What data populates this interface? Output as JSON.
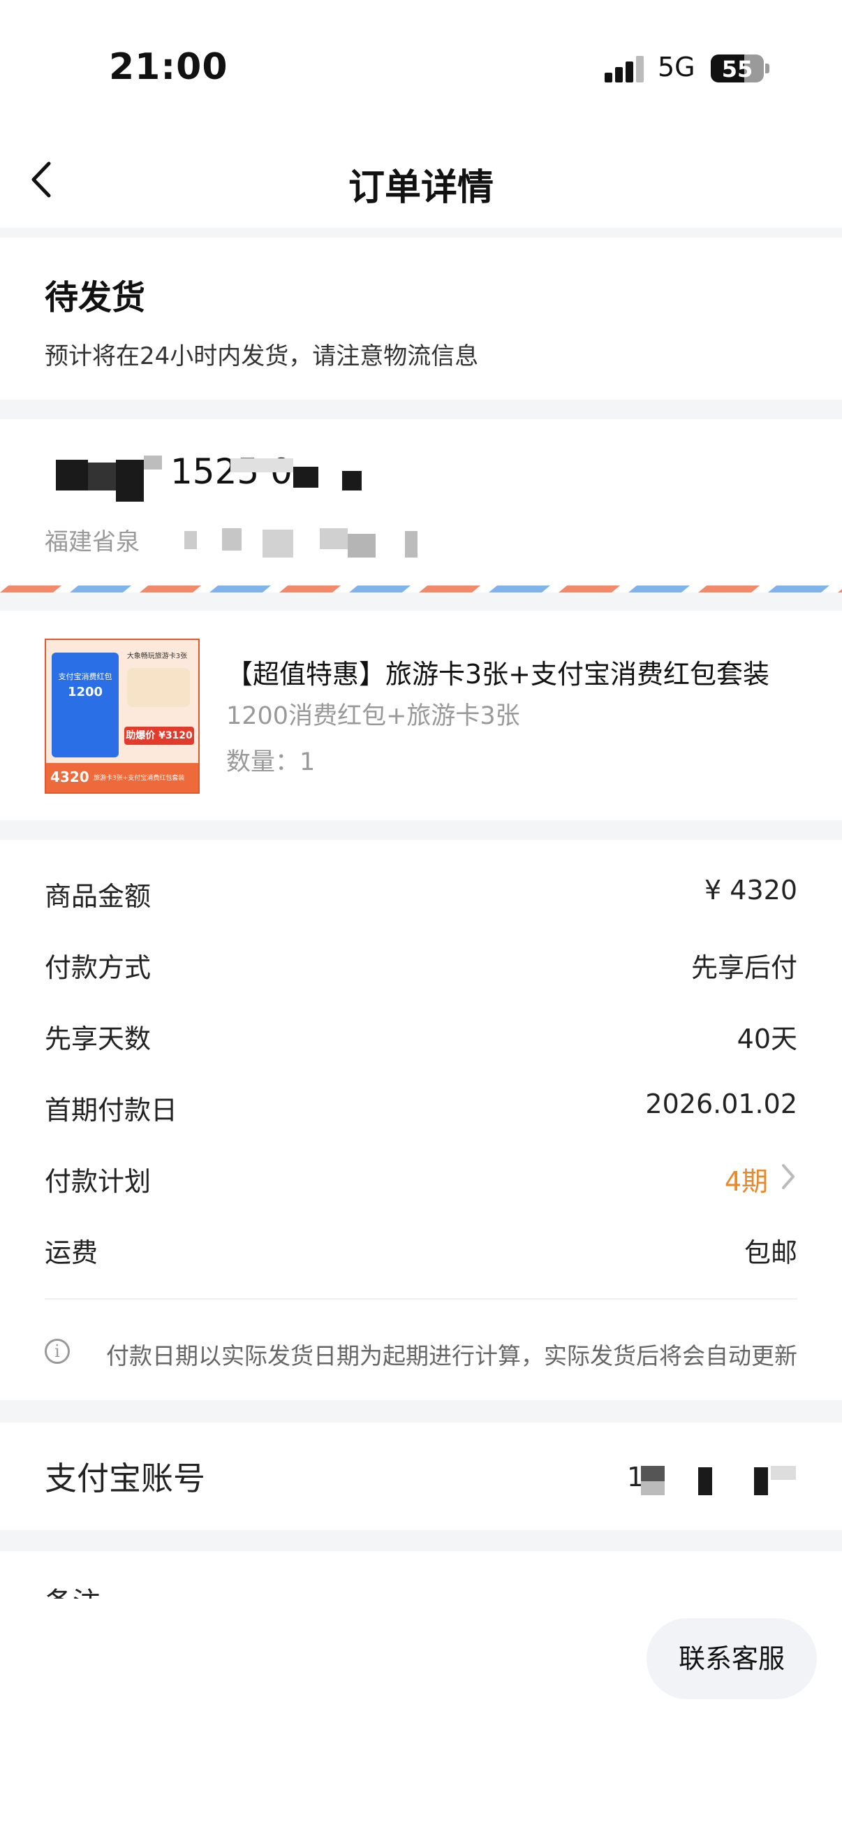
{
  "status_bar": {
    "time": "21:00",
    "network": "5G",
    "battery": "55"
  },
  "nav": {
    "title": "订单详情",
    "back_icon": "chevron-left-icon"
  },
  "order_status": {
    "title": "待发货",
    "subtitle": "预计将在24小时内发货，请注意物流信息"
  },
  "address": {
    "name_phone_visible": "1525 0",
    "region": "福建省泉"
  },
  "product": {
    "title": "【超值特惠】旅游卡3张+支付宝消费红包套装",
    "spec": "1200消费红包+旅游卡3张",
    "quantity": "数量：1",
    "thumb": {
      "card_title": "支付宝消费红包",
      "card_amount": "1200",
      "tag": "大象畅玩旅游卡3张",
      "price_label": "助爆价 ¥3120",
      "bottom_price": "4320",
      "bottom_text": "旅游卡3张+支付宝消费红包套装"
    }
  },
  "details": [
    {
      "label": "商品金额",
      "value": "¥ 4320"
    },
    {
      "label": "付款方式",
      "value": "先享后付"
    },
    {
      "label": "先享天数",
      "value": "40天"
    },
    {
      "label": "首期付款日",
      "value": "2026.01.02"
    },
    {
      "label": "付款计划",
      "value": "4期"
    },
    {
      "label": "运费",
      "value": "包邮"
    }
  ],
  "notice": "付款日期以实际发货日期为起期进行计算，实际发货后将会自动更新",
  "alipay_account": {
    "label": "支付宝账号",
    "value_visible": "1"
  },
  "remark": {
    "label": "备注"
  },
  "contact_button": "联系客服",
  "colors": {
    "accent": "#e8882c",
    "separator": "#f4f5f7",
    "muted": "#999999"
  }
}
